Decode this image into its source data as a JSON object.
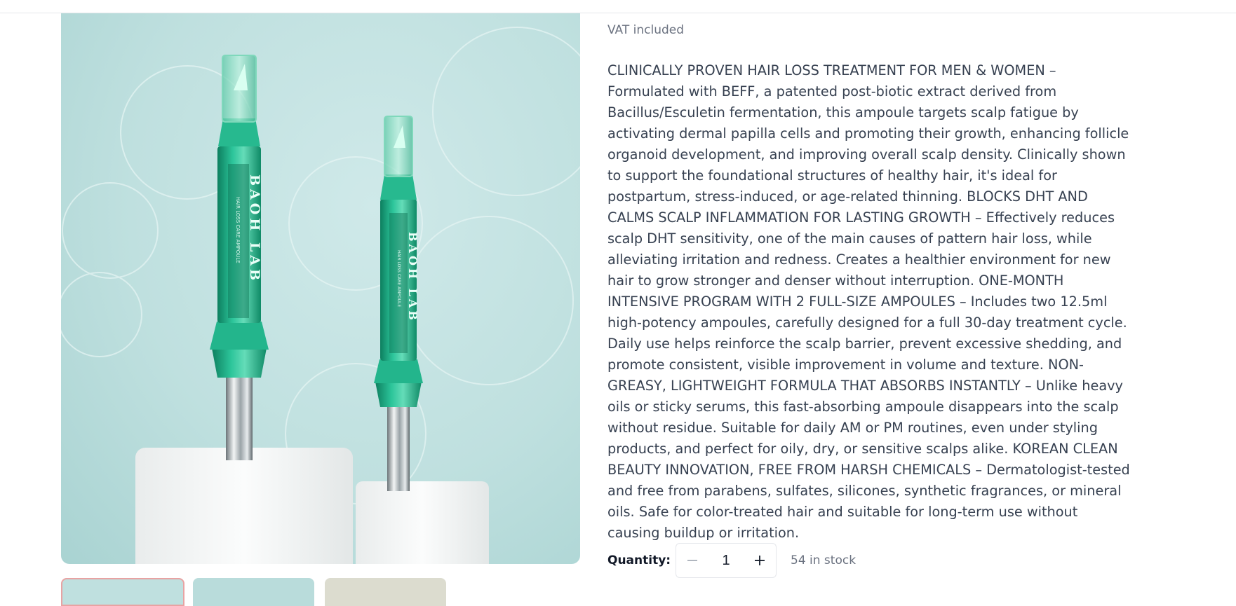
{
  "product": {
    "vat_note": "VAT included",
    "description": "CLINICALLY PROVEN HAIR LOSS TREATMENT FOR MEN & WOMEN – Formulated with BEFF, a patented post-biotic extract derived from Bacillus/Esculetin fermentation, this ampoule targets scalp fatigue by activating dermal papilla cells and promoting their growth, enhancing follicle organoid development, and improving overall scalp density. Clinically shown to support the foundational structures of healthy hair, it's ideal for postpartum, stress-induced, or age-related thinning. BLOCKS DHT AND CALMS SCALP INFLAMMATION FOR LASTING GROWTH – Effectively reduces scalp DHT sensitivity, one of the main causes of pattern hair loss, while alleviating irritation and redness. Creates a healthier environment for new hair to grow stronger and denser without interruption. ONE-MONTH INTENSIVE PROGRAM WITH 2 FULL-SIZE AMPOULES – Includes two 12.5ml high-potency ampoules, carefully designed for a full 30-day treatment cycle. Daily use helps reinforce the scalp barrier, prevent excessive shedding, and promote consistent, visible improvement in volume and texture. NON-GREASY, LIGHTWEIGHT FORMULA THAT ABSORBS INSTANTLY – Unlike heavy oils or sticky serums, this fast-absorbing ampoule disappears into the scalp without residue. Suitable for daily AM or PM routines, even under styling products, and perfect for oily, dry, or sensitive scalps alike. KOREAN CLEAN BEAUTY INNOVATION, FREE FROM HARSH CHEMICALS – Dermatologist-tested and free from parabens, sulfates, silicones, synthetic fragrances, or mineral oils. Safe for color-treated hair and suitable for long-term use without causing buildup or irritation.",
    "image": {
      "brand_text": "BAOH LAB",
      "sub_text": "HAIR LOSS CARE AMPOULE"
    }
  },
  "quantity": {
    "label": "Quantity:",
    "value": "1",
    "decrease_icon": "minus-icon",
    "increase_icon": "plus-icon",
    "stock": "54 in stock"
  },
  "colors": {
    "accent_ampoule": "#1fae85",
    "background_image": "#bfe0df",
    "thumb_active_border": "#e8a3a3"
  }
}
